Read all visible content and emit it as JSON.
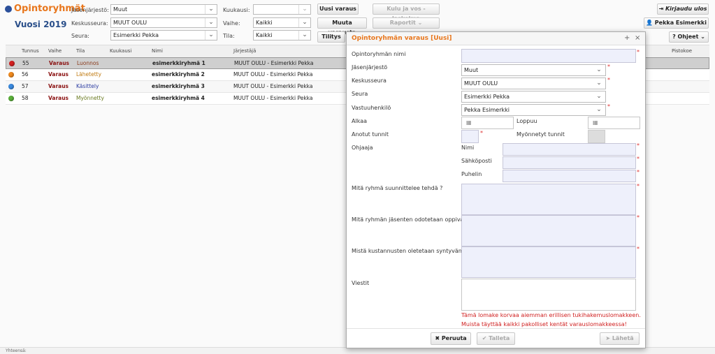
{
  "app": {
    "title": "Opintoryhmät",
    "year": "Vuosi 2019"
  },
  "filters": {
    "jasenjarjesto_label": "Jäsenjärjestö:",
    "jasenjarjesto_value": "Muut",
    "keskusseura_label": "Keskusseura:",
    "keskusseura_value": "MUUT OULU",
    "seura_label": "Seura:",
    "seura_value": "Esimerkki Pekka",
    "kuukausi_label": "Kuukausi:",
    "kuukausi_value": "",
    "vaihe_label": "Vaihe:",
    "vaihe_value": "Kaikki",
    "tila_label": "Tila:",
    "tila_value": "Kaikki"
  },
  "toolbar": {
    "uusi_varaus": "Uusi varaus",
    "kulu_laskelma": "Kulu ja vos -laskelma",
    "muuta_varausta": "Muuta varausta",
    "raportit": "Raportit",
    "tilitys": "Tilitys",
    "kirjaudu_ulos": "Kirjaudu ulos",
    "user": "Pekka Esimerkki",
    "ohjeet": "Ohjeet"
  },
  "table": {
    "headers": [
      "Tunnus",
      "Vaihe",
      "Tila",
      "Kuukausi",
      "Nimi",
      "Järjestäjä",
      "Pistokoe"
    ],
    "rows": [
      {
        "status_color": "#d42020",
        "tunnus": "55",
        "vaihe": "Varaus",
        "tila": "Luonnos",
        "tila_color": "#8a3a1a",
        "kuukausi": "",
        "nimi": "esimerkkiryhmä 1",
        "jarjestaja": "MUUT OULU - Esimerkki Pekka"
      },
      {
        "status_color": "#f08a1e",
        "tunnus": "56",
        "vaihe": "Varaus",
        "tila": "Lähetetty",
        "tila_color": "#c07a10",
        "kuukausi": "",
        "nimi": "esimerkkiryhmä 2",
        "jarjestaja": "MUUT OULU - Esimerkki Pekka"
      },
      {
        "status_color": "#3a8ae0",
        "tunnus": "57",
        "vaihe": "Varaus",
        "tila": "Käsittely",
        "tila_color": "#2a3aa0",
        "kuukausi": "",
        "nimi": "esimerkkiryhmä 3",
        "jarjestaja": "MUUT OULU - Esimerkki Pekka"
      },
      {
        "status_color": "#5ab03a",
        "tunnus": "58",
        "vaihe": "Varaus",
        "tila": "Myönnetty",
        "tila_color": "#6a7a20",
        "kuukausi": "",
        "nimi": "esimerkkiryhmä 4",
        "jarjestaja": "MUUT OULU - Esimerkki Pekka"
      }
    ]
  },
  "footer": {
    "text": "Yhteensä:"
  },
  "dialog": {
    "title": "Opintoryhmän varaus [Uusi]",
    "opintoryhman_nimi_label": "Opintoryhmän nimi",
    "jasenjarjesto_label": "Jäsenjärjestö",
    "jasenjarjesto_value": "Muut",
    "keskusseura_label": "Keskusseura",
    "keskusseura_value": "MUUT OULU",
    "seura_label": "Seura",
    "seura_value": "Esimerkki Pekka",
    "vastuuhenkilo_label": "Vastuuhenkilö",
    "vastuuhenkilo_value": "Pekka Esimerkki",
    "alkaa_label": "Alkaa",
    "loppuu_label": "Loppuu",
    "anotut_label": "Anotut tunnit",
    "myonnetyt_label": "Myönnetyt tunnit",
    "ohjaaja_label": "Ohjaaja",
    "nimi_label": "Nimi",
    "sahkoposti_label": "Sähköposti",
    "puhelin_label": "Puhelin",
    "q1_label": "Mitä ryhmä suunnittelee tehdä ?",
    "q2_label": "Mitä ryhmän jäsenten odotetaan oppivan?",
    "q3_label": "Mistä kustannusten oletetaan syntyvän?",
    "viestit_label": "Viestit",
    "notice1": "Tämä lomake korvaa aiemman erillisen tukihakemuslomakkeen.",
    "notice2": "Muista täyttää kaikki pakolliset kentät varauslomakkeessa!",
    "peruuta": "Peruuta",
    "talleta": "Talleta",
    "laheta": "Lähetä"
  },
  "colors": {
    "brand_orange": "#e8761c",
    "title_blue": "#2a4f8a",
    "required": "#d33333",
    "notice_red": "#d02020"
  }
}
